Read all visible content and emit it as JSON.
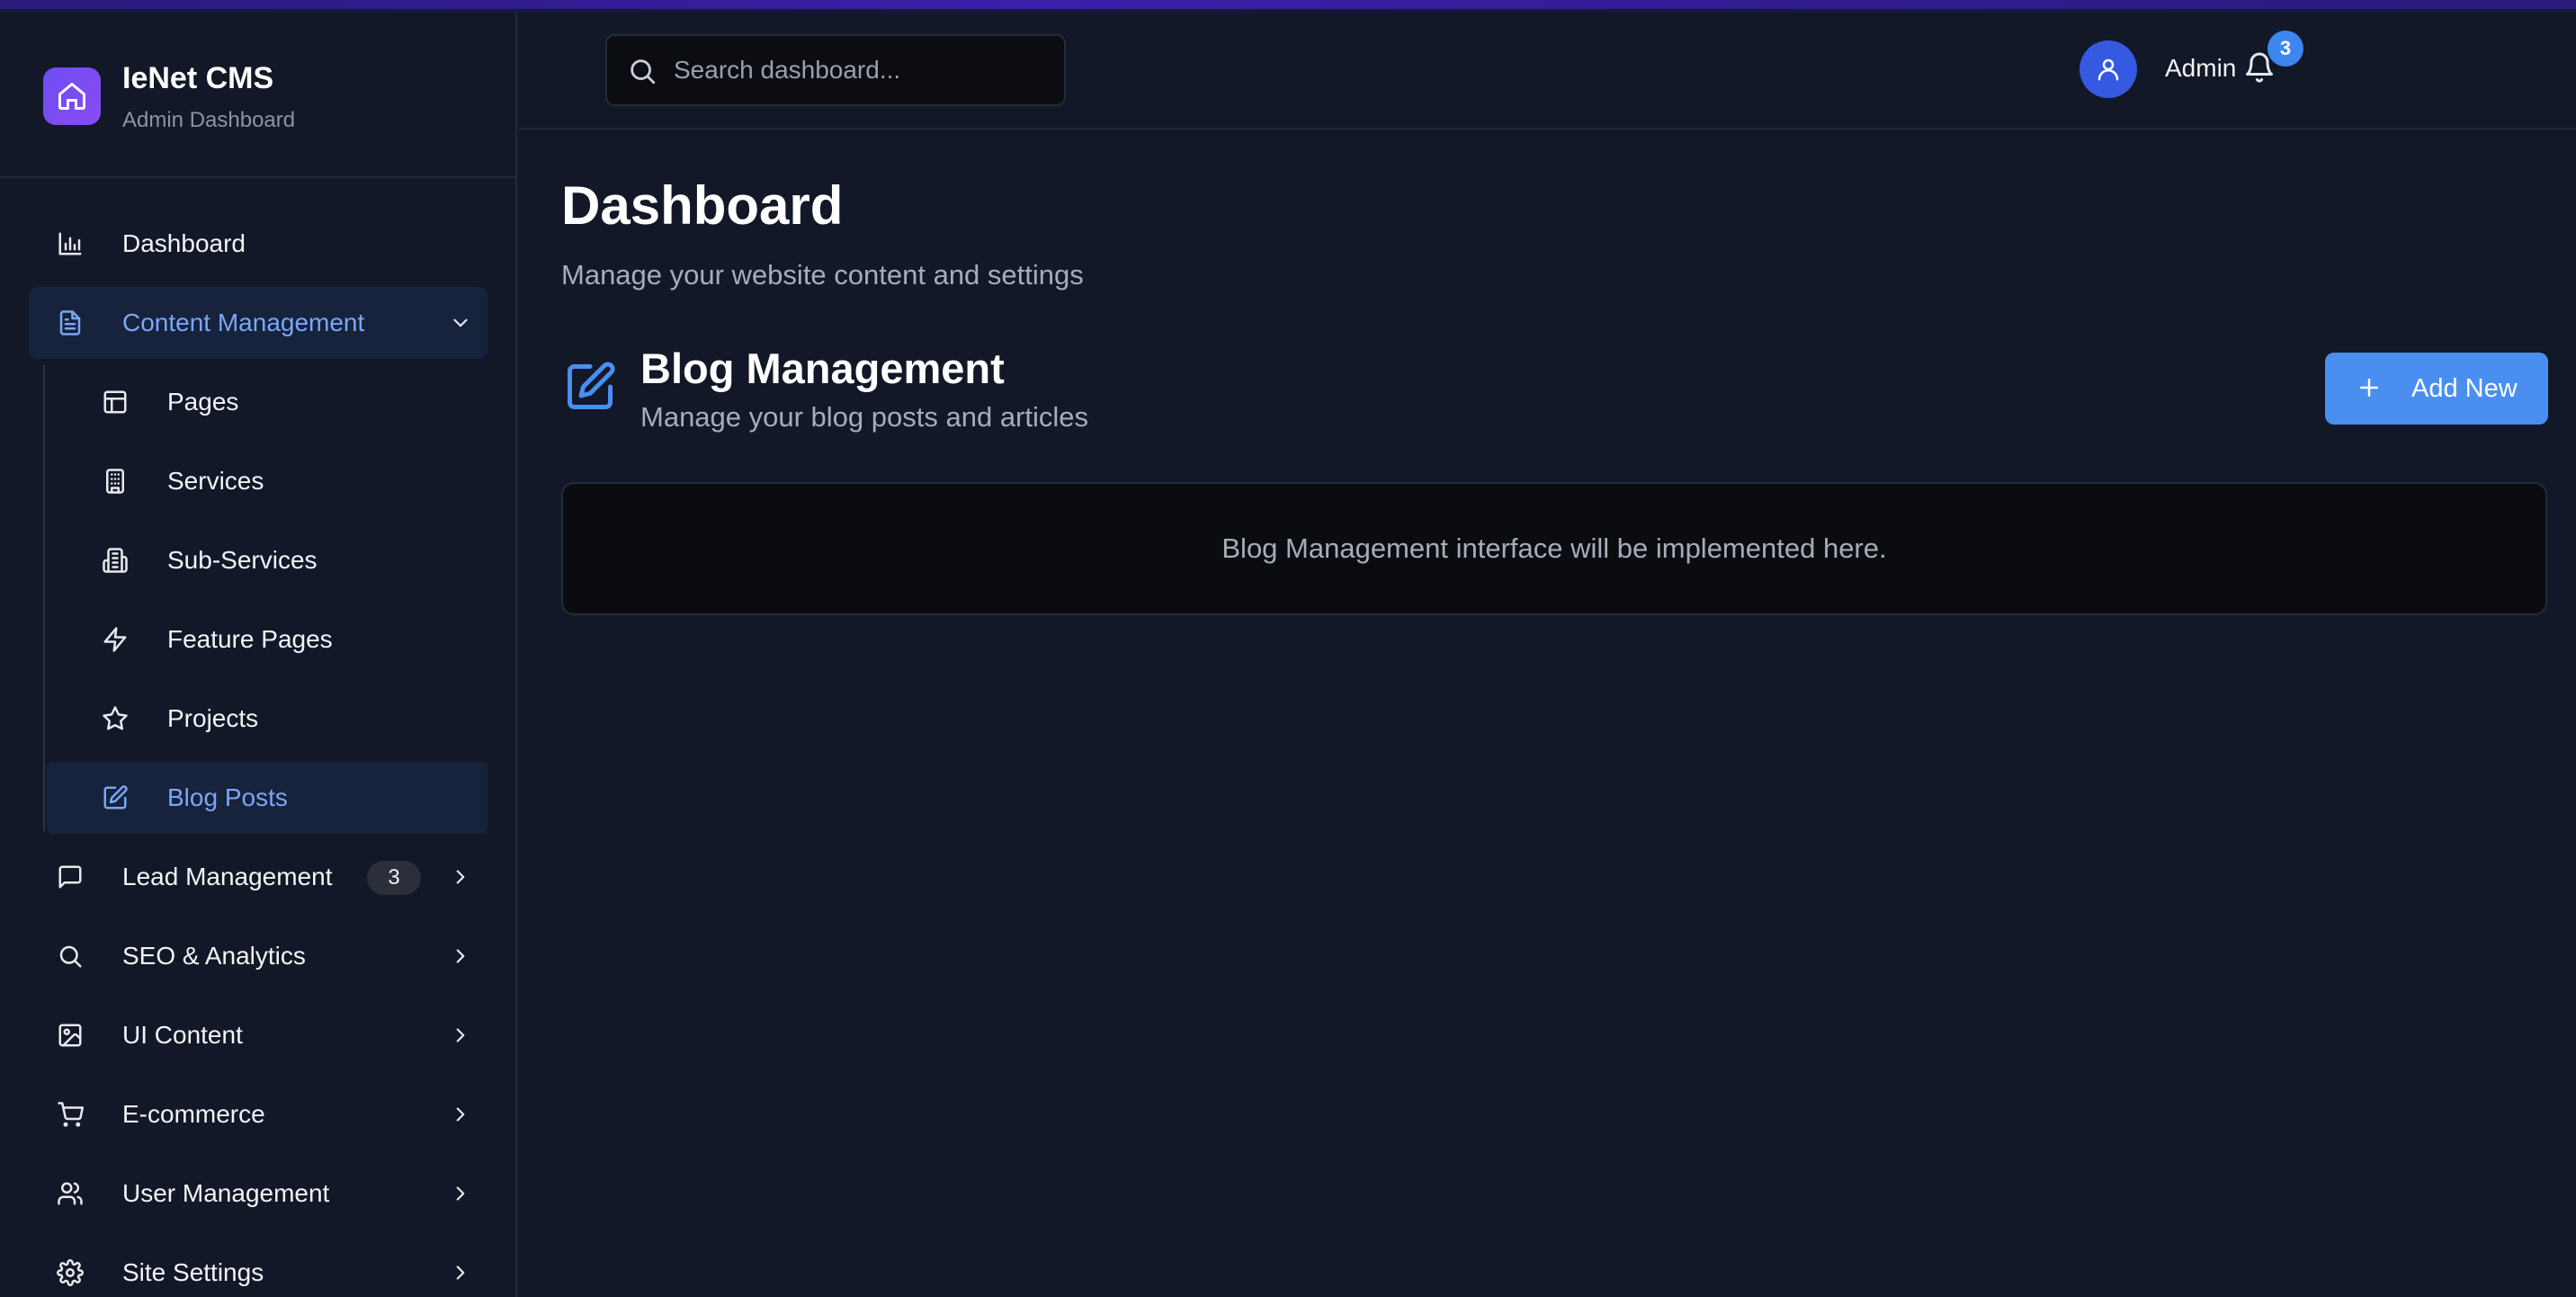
{
  "brand": {
    "title": "IeNet CMS",
    "subtitle": "Admin Dashboard",
    "logo_icon": "home-icon"
  },
  "sidebar": {
    "items": [
      {
        "id": "dashboard",
        "label": "Dashboard",
        "icon": "bar-chart-icon"
      },
      {
        "id": "content-management",
        "label": "Content Management",
        "icon": "document-icon",
        "expanded": true
      },
      {
        "id": "lead-management",
        "label": "Lead Management",
        "icon": "message-icon",
        "badge": "3"
      },
      {
        "id": "seo-analytics",
        "label": "SEO & Analytics",
        "icon": "search-icon"
      },
      {
        "id": "ui-content",
        "label": "UI Content",
        "icon": "image-icon"
      },
      {
        "id": "e-commerce",
        "label": "E-commerce",
        "icon": "cart-icon"
      },
      {
        "id": "user-management",
        "label": "User Management",
        "icon": "users-icon"
      },
      {
        "id": "site-settings",
        "label": "Site Settings",
        "icon": "gear-icon"
      }
    ],
    "content_subitems": [
      {
        "id": "pages",
        "label": "Pages",
        "icon": "layout-icon"
      },
      {
        "id": "services",
        "label": "Services",
        "icon": "building-icon"
      },
      {
        "id": "sub-services",
        "label": "Sub-Services",
        "icon": "buildings-icon"
      },
      {
        "id": "feature-pages",
        "label": "Feature Pages",
        "icon": "lightning-icon"
      },
      {
        "id": "projects",
        "label": "Projects",
        "icon": "star-icon"
      },
      {
        "id": "blog-posts",
        "label": "Blog Posts",
        "icon": "edit-icon",
        "active": true
      }
    ]
  },
  "header": {
    "search_placeholder": "Search dashboard...",
    "notification_count": "3",
    "user_name": "Admin"
  },
  "main": {
    "title": "Dashboard",
    "subtitle": "Manage your website content and settings",
    "section": {
      "title": "Blog Management",
      "subtitle": "Manage your blog posts and articles",
      "add_button_label": "Add New",
      "placeholder_text": "Blog Management interface will be implemented here."
    }
  },
  "colors": {
    "background": "#121827",
    "accent": "#4a8ff0",
    "active_text": "#7aa7f5",
    "active_bg": "#17223c",
    "brand_gradient_start": "#6d4df2",
    "brand_gradient_end": "#8a4cf0"
  }
}
